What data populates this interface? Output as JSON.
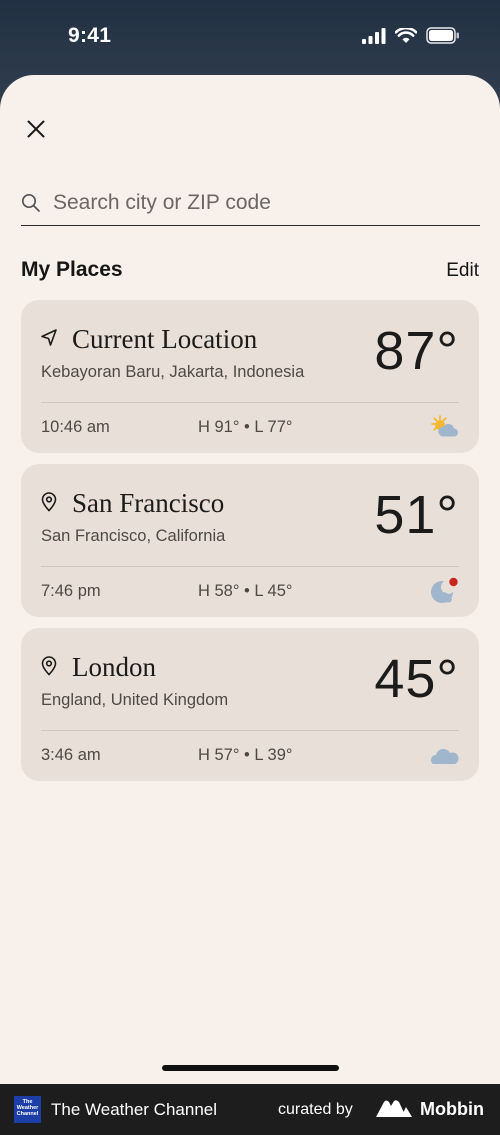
{
  "status": {
    "time": "9:41"
  },
  "search": {
    "placeholder": "Search city or ZIP code"
  },
  "places": {
    "title": "My Places",
    "edit_label": "Edit",
    "items": [
      {
        "name": "Current Location",
        "sub": "Kebayoran Baru, Jakarta, Indonesia",
        "temp": "87°",
        "time": "10:46 am",
        "hilo": "H 91° • L 77°",
        "icon": "location-arrow-icon",
        "weather": "partly-sunny-icon"
      },
      {
        "name": "San Francisco",
        "sub": "San Francisco, California",
        "temp": "51°",
        "time": "7:46 pm",
        "hilo": "H 58° • L 45°",
        "icon": "map-pin-icon",
        "weather": "night-cloudy-alert-icon"
      },
      {
        "name": "London",
        "sub": "England, United Kingdom",
        "temp": "45°",
        "time": "3:46 am",
        "hilo": "H 57° • L 39°",
        "icon": "map-pin-icon",
        "weather": "cloudy-icon"
      }
    ]
  },
  "footer": {
    "logo_text": "The Weather Channel",
    "brand": "The Weather Channel",
    "curated": "curated by",
    "mobbin": "Mobbin"
  },
  "colors": {
    "sheet": "#f8f0ea",
    "card": "#e8e0d8",
    "sun": "#f4b731",
    "cloud": "#9fb6cc",
    "alert": "#c8261c"
  }
}
